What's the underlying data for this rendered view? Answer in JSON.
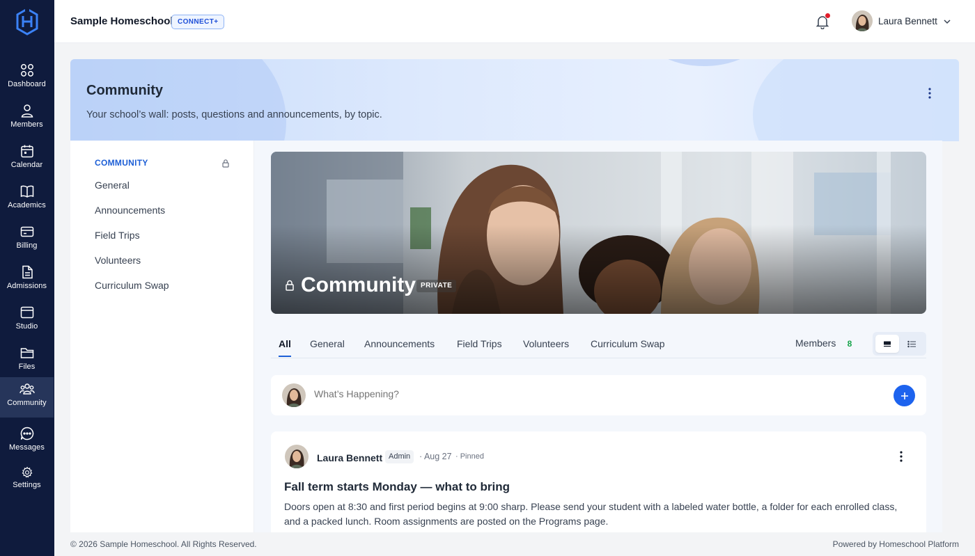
{
  "app": {
    "school_name": "Sample Homeschool",
    "plan_badge": "CONNECT+"
  },
  "sidebar": {
    "items": [
      {
        "label": "Dashboard",
        "icon": "grid-icon"
      },
      {
        "label": "Members",
        "icon": "person-icon"
      },
      {
        "label": "Calendar",
        "icon": "calendar-icon"
      },
      {
        "label": "Academics",
        "icon": "book-icon"
      },
      {
        "label": "Billing",
        "icon": "credit-card-icon"
      },
      {
        "label": "Admissions",
        "icon": "document-icon"
      },
      {
        "label": "Studio",
        "icon": "window-icon"
      },
      {
        "label": "Files",
        "icon": "folder-icon"
      },
      {
        "label": "Community",
        "icon": "people-icon",
        "active": true
      },
      {
        "label": "Messages",
        "icon": "chat-icon"
      },
      {
        "label": "Settings",
        "icon": "gear-icon"
      }
    ]
  },
  "user": {
    "name": "Laura Bennett",
    "has_notification": true
  },
  "header": {
    "title": "Community",
    "subtitle": "Your school’s wall: posts, questions and announcements, by topic."
  },
  "topics": {
    "heading": "COMMUNITY",
    "items": [
      "General",
      "Announcements",
      "Field Trips",
      "Volunteers",
      "Curriculum Swap"
    ]
  },
  "cover": {
    "title": "Community",
    "badge": "PRIVATE"
  },
  "tabs": {
    "items": [
      "All",
      "General",
      "Announcements",
      "Field Trips",
      "Volunteers",
      "Curriculum Swap"
    ],
    "active": "All",
    "members_label": "Members",
    "members_count": "8"
  },
  "composer": {
    "placeholder": "What’s Happening?"
  },
  "post": {
    "author": "Laura Bennett",
    "role": "Admin",
    "date": "· Aug 27",
    "pinned": "· Pinned",
    "title": "Fall term starts Monday — what to bring",
    "body": "Doors open at 8:30 and first period begins at 9:00 sharp. Please send your student with a labeled water bottle, a folder for each enrolled class, and a packed lunch. Room assignments are posted on the Programs page."
  },
  "footer": {
    "copyright": "© 2026 Sample Homeschool. All Rights Reserved.",
    "powered_by": "Powered by Homeschool Platform"
  },
  "colors": {
    "sidebar_bg": "#0f1b3d",
    "accent": "#1d5fd6",
    "primary_button": "#1d63ee",
    "notification": "#e11d2a",
    "members_count": "#16a34a"
  }
}
